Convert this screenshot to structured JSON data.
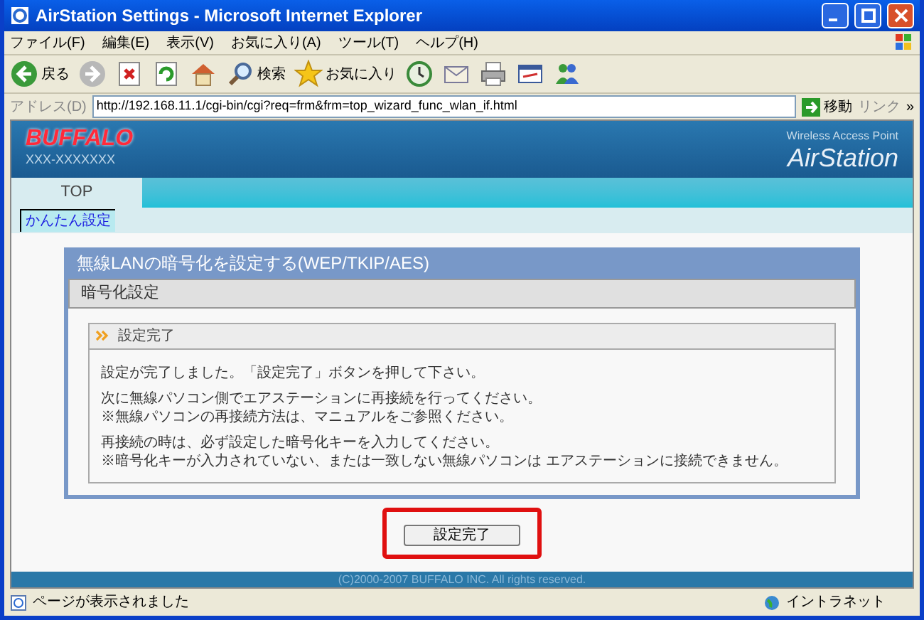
{
  "window": {
    "title": "AirStation Settings - Microsoft Internet Explorer"
  },
  "menu": [
    "ファイル(F)",
    "編集(E)",
    "表示(V)",
    "お気に入り(A)",
    "ツール(T)",
    "ヘルプ(H)"
  ],
  "toolbar": [
    {
      "kind": "back",
      "label": "戻る"
    },
    {
      "kind": "forward"
    },
    {
      "kind": "stop"
    },
    {
      "kind": "refresh"
    },
    {
      "kind": "home"
    },
    {
      "kind": "search",
      "label": "検索"
    },
    {
      "kind": "favorites",
      "label": "お気に入り"
    },
    {
      "kind": "history"
    },
    {
      "kind": "mail"
    },
    {
      "kind": "print"
    },
    {
      "kind": "edit"
    },
    {
      "kind": "messenger"
    }
  ],
  "address": {
    "label": "アドレス(D)",
    "value": "http://192.168.11.1/cgi-bin/cgi?req=frm&frm=top_wizard_func_wlan_if.html",
    "go": "移動",
    "links": "リンク",
    "more": "»"
  },
  "header": {
    "logo": "BUFFALO",
    "model": "XXX-XXXXXXX",
    "tagline": "Wireless Access Point",
    "product": "AirStation"
  },
  "tabs": [
    {
      "label": "TOP",
      "selected": true
    }
  ],
  "subnav": [
    {
      "label": "かんたん設定",
      "selected": true
    }
  ],
  "panel": {
    "title": "無線LANの暗号化を設定する(WEP/TKIP/AES)",
    "section": "暗号化設定",
    "box_title": "設定完了",
    "paragraphs": [
      [
        "設定が完了しました。「設定完了」ボタンを押して下さい。"
      ],
      [
        "次に無線パソコン側でエアステーションに再接続を行ってください。",
        "※無線パソコンの再接続方法は、マニュアルをご参照ください。"
      ],
      [
        "再接続の時は、必ず設定した暗号化キーを入力してください。",
        "※暗号化キーが入力されていない、または一致しない無線パソコンは エアステーションに接続できません。"
      ]
    ]
  },
  "button": {
    "label": "設定完了",
    "highlighted": true
  },
  "footer": "(C)2000-2007 BUFFALO INC. All rights reserved.",
  "status": {
    "text": "ページが表示されました",
    "zone": "イントラネット"
  }
}
